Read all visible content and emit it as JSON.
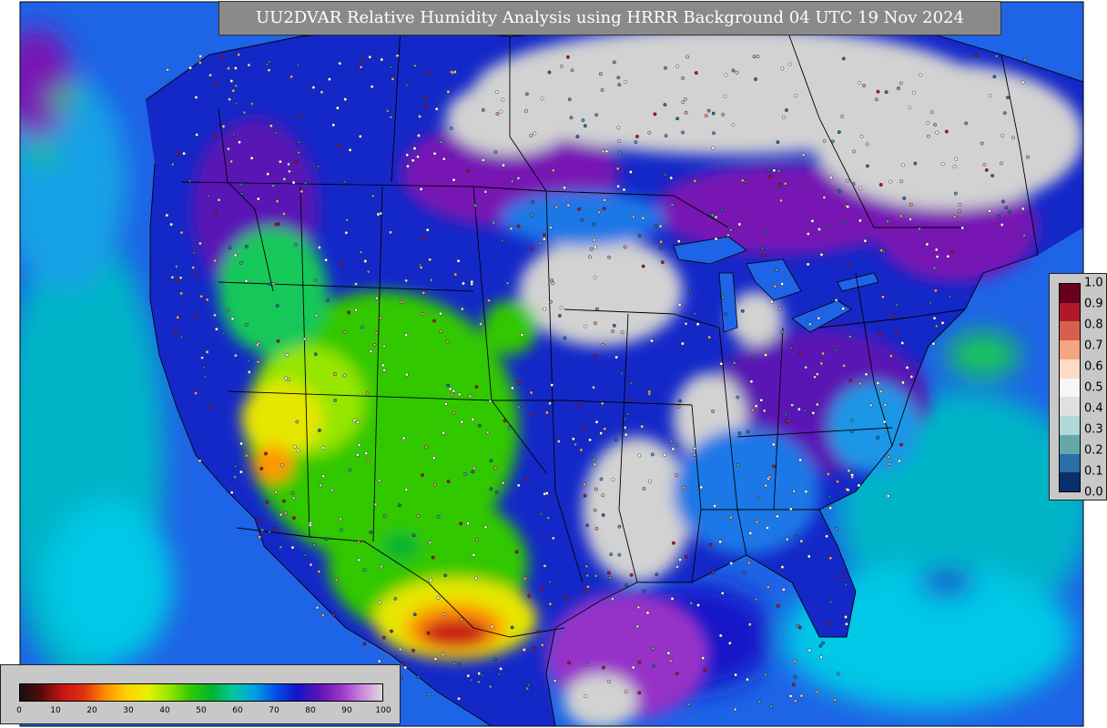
{
  "title": "UU2DVAR Relative Humidity Analysis using HRRR Background 04 UTC 19 Nov 2024",
  "rh_legend": {
    "ticks": [
      "0",
      "10",
      "20",
      "30",
      "40",
      "50",
      "60",
      "70",
      "80",
      "90",
      "100"
    ],
    "colors": [
      "#111111",
      "#5a0a0a",
      "#c81414",
      "#e03010",
      "#ff8c00",
      "#ffd200",
      "#e6f000",
      "#96e600",
      "#32c800",
      "#00b432",
      "#00c8a0",
      "#00a0e6",
      "#0050e6",
      "#1414c8",
      "#5a14b4",
      "#9632c8",
      "#c882dc",
      "#dcdcdc"
    ]
  },
  "increment_legend": {
    "ticks": [
      "1.0",
      "0.9",
      "0.8",
      "0.7",
      "0.6",
      "0.5",
      "0.4",
      "0.3",
      "0.2",
      "0.1",
      "0.0"
    ],
    "colors": [
      "#67001f",
      "#b2182b",
      "#d6604d",
      "#f4a582",
      "#fddbc7",
      "#f7f7f7",
      "#e0e0e0",
      "#b2d8d8",
      "#66a8a8",
      "#2c6fa8",
      "#08306b"
    ]
  },
  "map": {
    "colors": {
      "ocean_deep": "#1e64e6",
      "ocean_teal": "#00b4c8",
      "ocean_cyan": "#00c8e6",
      "ocean_green": "#14c85a",
      "land_blue": "#1428c8",
      "land_purple": "#7814b4",
      "land_gray": "#d2d2d2",
      "arid_green": "#32c800",
      "arid_yellow": "#e6e600",
      "arid_orange": "#ff9600",
      "arid_red": "#c81414",
      "border": "#000000"
    }
  }
}
